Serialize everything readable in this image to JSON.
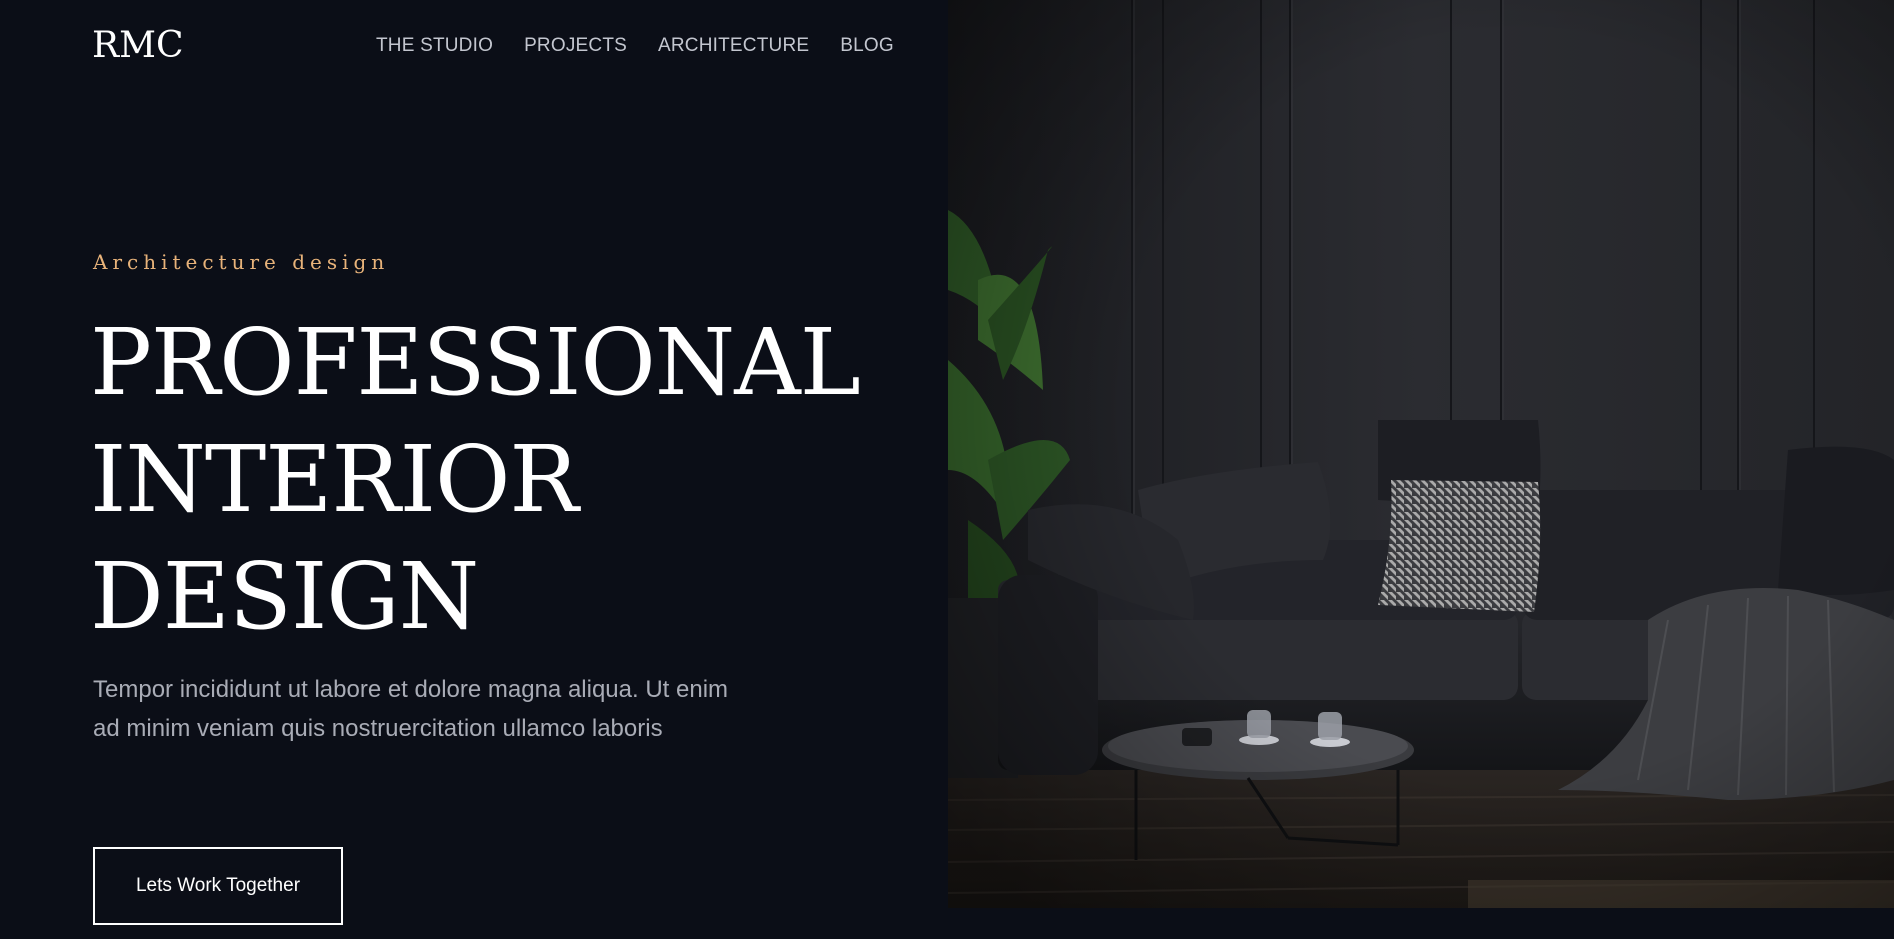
{
  "brand": {
    "logo": "RMC"
  },
  "nav": {
    "items": [
      {
        "label": "THE STUDIO"
      },
      {
        "label": "PROJECTS"
      },
      {
        "label": "ARCHITECTURE"
      },
      {
        "label": "BLOG"
      }
    ]
  },
  "hero": {
    "eyebrow": "Architecture design",
    "headline": [
      "PROFESSIONAL",
      "INTERIOR",
      "DESIGN"
    ],
    "description": "Tempor incididunt ut labore et dolore magna aliqua. Ut enim ad minim veniam quis nostruercitation ullamco laboris",
    "cta_label": "Lets Work Together"
  },
  "colors": {
    "background": "#0b0e17",
    "accent": "#e8b37a",
    "text_primary": "#ffffff",
    "text_muted": "#a9acb6"
  }
}
